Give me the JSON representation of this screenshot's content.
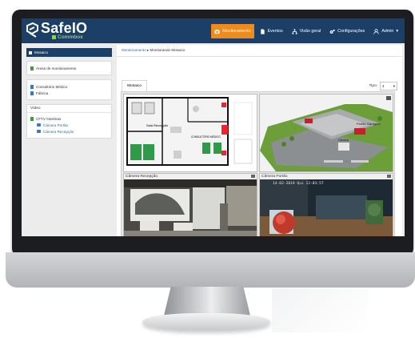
{
  "app": {
    "logo_text": "SafeIO",
    "logo_sub": "Commbox"
  },
  "navbar": {
    "items": [
      {
        "label": "Monitoramento",
        "icon": "camera-icon",
        "active": true
      },
      {
        "label": "Eventos",
        "icon": "document-icon",
        "active": false
      },
      {
        "label": "Visão geral",
        "icon": "sitemap-icon",
        "active": false
      },
      {
        "label": "Configurações",
        "icon": "gears-icon",
        "active": false
      },
      {
        "label": "Admin",
        "icon": "user-icon",
        "active": false
      }
    ]
  },
  "sidebar": {
    "header_label": "Mosaico",
    "group1": [
      {
        "label": "Áreas de monitoramento",
        "color": "green"
      }
    ],
    "group2": [
      {
        "label": "Consultório Médico",
        "color": "blue"
      },
      {
        "label": "Fábrica",
        "color": "blue"
      }
    ],
    "video": {
      "title": "Vídeo",
      "parent": "CFTV Interbras",
      "children": [
        "Câmera Portão",
        "Câmera Recepção"
      ]
    }
  },
  "main": {
    "breadcrumb": {
      "root": "Monitoramento",
      "separator": "▸",
      "current": "Monitorando Mosaico"
    },
    "tab": "Mosaico",
    "tipo_label": "Tipo:",
    "tipo_value": "4",
    "tiles": [
      {
        "title": "",
        "kind": "floorplan",
        "labels": [
          "Sala Recepção",
          "CONSULTÓRIO MÉDICO"
        ]
      },
      {
        "title": "",
        "kind": "3d-map",
        "labels": [
          "Portão Garagem",
          "Câmera"
        ]
      },
      {
        "title": "Câmera Recepção",
        "kind": "camera"
      },
      {
        "title": "Câmera Portão",
        "kind": "camera",
        "timestamp": "14-02-2019 Qui 12:03:57"
      }
    ]
  },
  "colors": {
    "navbar": "#1b3f66",
    "accent": "#ef8a1c",
    "brand_green": "#8fd14f"
  }
}
